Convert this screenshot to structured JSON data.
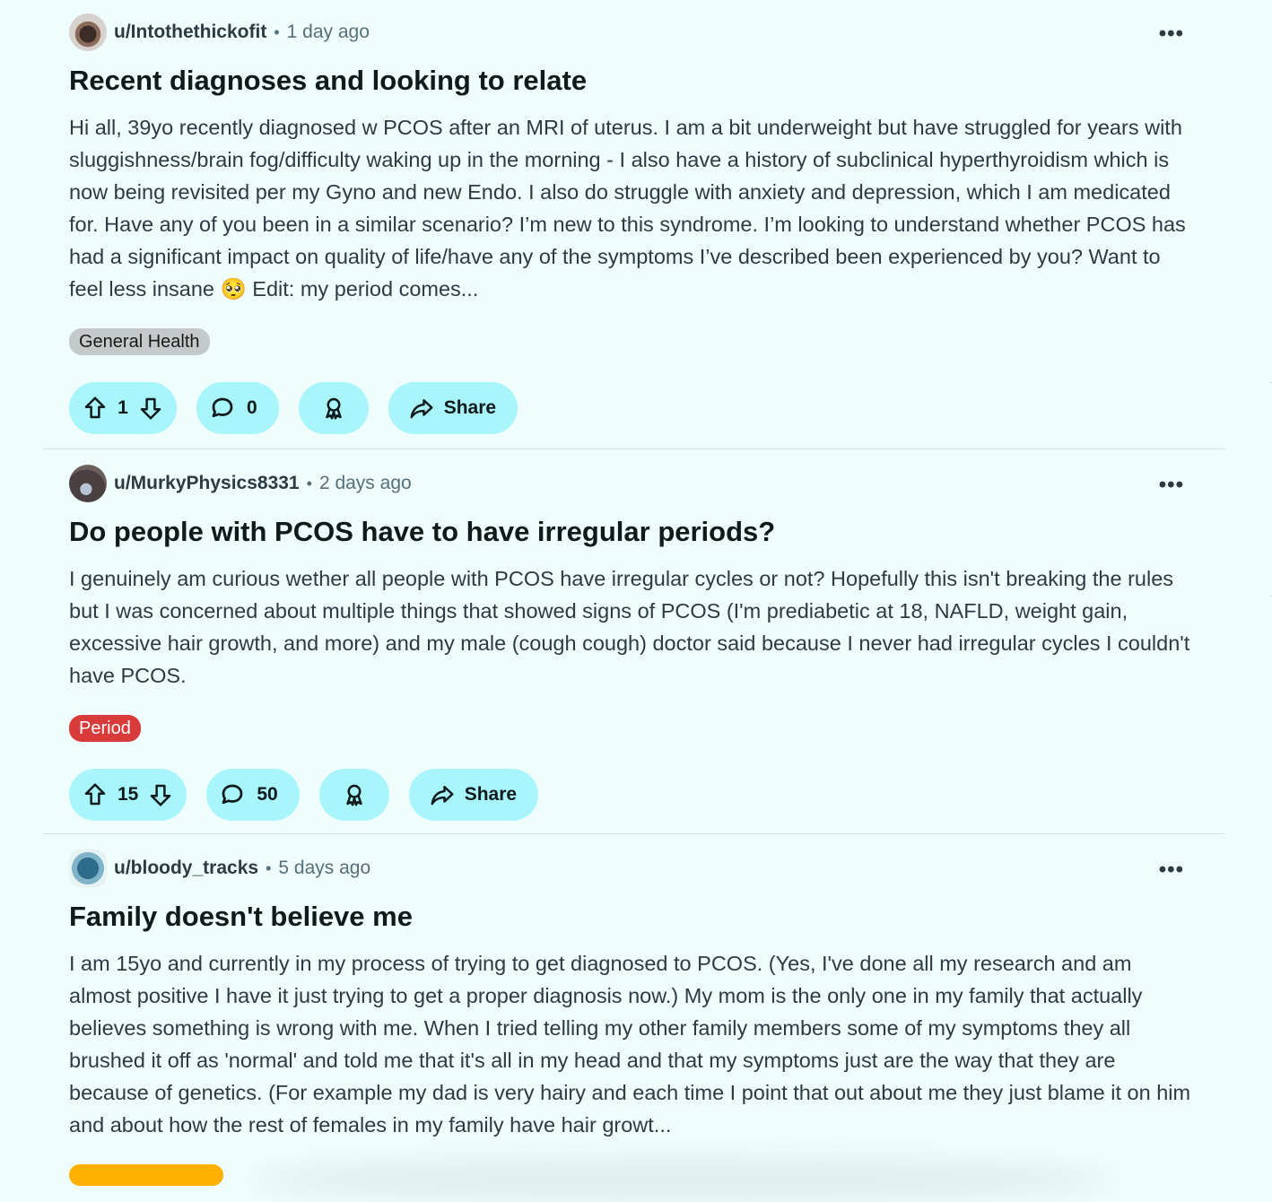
{
  "posts": [
    {
      "username": "u/Intothethickofit",
      "time": "1 day ago",
      "title": "Recent diagnoses and looking to relate",
      "body": "Hi all, 39yo recently diagnosed w PCOS after an MRI of uterus. I am a bit underweight but have struggled for years with sluggishness/brain fog/difficulty waking up in the morning - I also have a history of subclinical hyperthyroidism which is now being revisited per my Gyno and new Endo. I also do struggle with anxiety and depression, which I am medicated for. Have any of you been in a similar scenario? I’m new to this syndrome. I’m looking to understand whether PCOS has had a significant impact on quality of life/have any of the symptoms I’ve described been experienced by you? Want to feel less insane 🥺 Edit: my period comes...",
      "flair": "General Health",
      "votes": "1",
      "comments": "0",
      "share": "Share"
    },
    {
      "username": "u/MurkyPhysics8331",
      "time": "2 days ago",
      "title": "Do people with PCOS have to have irregular periods?",
      "body": "I genuinely am curious wether all people with PCOS have irregular cycles or not? Hopefully this isn't breaking the rules but I was concerned about multiple things that showed signs of PCOS (I'm prediabetic at 18, NAFLD, weight gain, excessive hair growth, and more) and my male (cough cough) doctor said because I never had irregular cycles I couldn't have PCOS.",
      "flair": "Period",
      "votes": "15",
      "comments": "50",
      "share": "Share"
    },
    {
      "username": "u/bloody_tracks",
      "time": "5 days ago",
      "title": "Family doesn't believe me",
      "body": "I am 15yo and currently in my process of trying to get diagnosed to PCOS. (Yes, I've done all my research and am almost positive I have it just trying to get a proper diagnosis now.) My mom is the only one in my family that actually believes something is wrong with me. When I tried telling my other family members some of my symptoms they all brushed it off as 'normal' and told me that it's all in my head and that my symptoms just are the way that they are because of genetics. (For example my dad is very hairy and each time I point that out about me they just blame it on him and about how the rest of females in my family have hair growt..."
    }
  ],
  "dot": "•",
  "more": "•••"
}
